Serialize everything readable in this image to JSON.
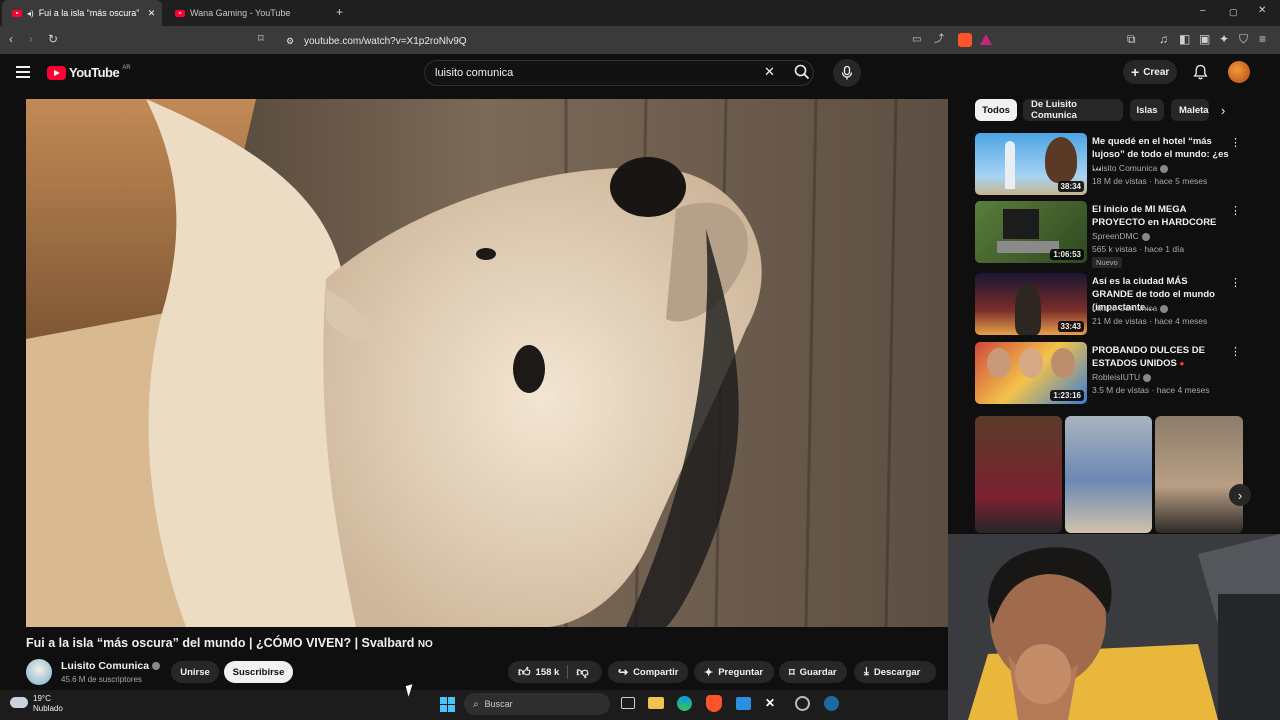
{
  "browser": {
    "tabs": [
      {
        "title": "Fui a la isla “más oscura” del",
        "active": true
      },
      {
        "title": "Wana Gaming - YouTube",
        "active": false
      }
    ],
    "url": "youtube.com/watch?v=X1p2roNlv9Q"
  },
  "youtube": {
    "logo_text": "YouTube",
    "region": "AR",
    "search_value": "luisito comunica",
    "create_label": "Crear",
    "chips": [
      "Todos",
      "De Luisito Comunica",
      "Islas",
      "Maleta"
    ],
    "recommendations": [
      {
        "title": "Me quedé en el hotel “más lujoso” de todo el mundo: ¿es …",
        "channel": "Luisito Comunica",
        "meta": "18 M de vistas · hace 5 meses",
        "duration": "38:34",
        "badge": ""
      },
      {
        "title": "El inicio de MI MEGA PROYECTO en HARDCORE",
        "channel": "SpreenDMC",
        "meta": "565 k vistas · hace 1 día",
        "duration": "1:06:53",
        "badge": "Nuevo"
      },
      {
        "title": "Así es la ciudad MÁS GRANDE de todo el mundo (impactante…",
        "channel": "Luisito Comunica",
        "meta": "21 M de vistas · hace 4 meses",
        "duration": "33:43",
        "badge": ""
      },
      {
        "title": "PROBANDO DULCES DE ESTADOS UNIDOS",
        "channel": "RobleisIUTU",
        "meta": "3.5 M de vistas · hace 4 meses",
        "duration": "1:23:16",
        "badge": ""
      }
    ],
    "video": {
      "title": "Fui a la isla “más oscura” del mundo | ¿CÓMO VIVEN? | Svalbard",
      "title_suffix": "NO",
      "channel": "Luisito Comunica",
      "subscribers": "45.6 M de suscriptores",
      "join_label": "Unirse",
      "subscribe_label": "Suscribirse",
      "likes": "158 k",
      "share_label": "Compartir",
      "ask_label": "Preguntar",
      "save_label": "Guardar",
      "download_label": "Descargar"
    }
  },
  "taskbar": {
    "temperature": "19°C",
    "weather": "Nublado",
    "search_placeholder": "Buscar"
  },
  "icons": {
    "menu": "hamburger-icon",
    "search": "search-icon",
    "mic": "mic-icon",
    "bell": "bell-icon",
    "like": "thumbs-up-icon",
    "dislike": "thumbs-down-icon"
  },
  "colors": {
    "brand": "#ff0033",
    "background": "#0f0f0f",
    "chip": "#272727"
  }
}
